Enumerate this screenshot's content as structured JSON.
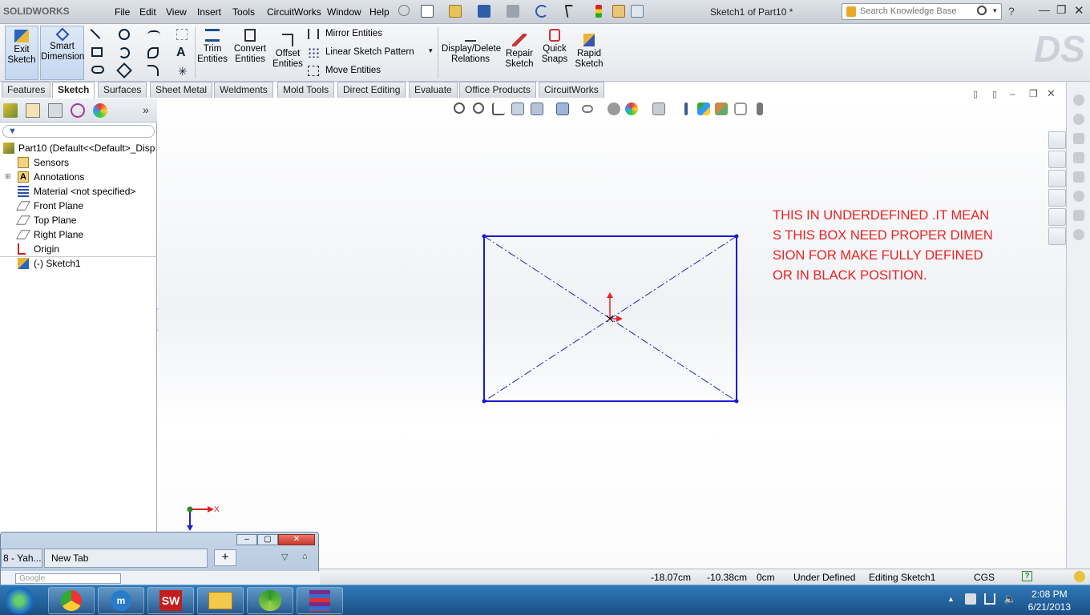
{
  "app": {
    "logo": "SOLIDWORKS",
    "doc_title": "Sketch1 of Part10 *"
  },
  "menu": [
    "File",
    "Edit",
    "View",
    "Insert",
    "Tools",
    "CircuitWorks",
    "Window",
    "Help"
  ],
  "search": {
    "placeholder": "Search Knowledge Base"
  },
  "ribbon": {
    "exit_sketch": "Exit Sketch",
    "smart_dimension": "Smart Dimension",
    "trim": "Trim Entities",
    "convert": "Convert Entities",
    "offset": "Offset Entities",
    "mirror": "Mirror Entities",
    "linear_pattern": "Linear Sketch Pattern",
    "move": "Move Entities",
    "display_delete": "Display/Delete Relations",
    "repair": "Repair Sketch",
    "quick_snaps": "Quick Snaps",
    "rapid": "Rapid Sketch"
  },
  "tabs": [
    "Features",
    "Sketch",
    "Surfaces",
    "Sheet Metal",
    "Weldments",
    "Mold Tools",
    "Direct Editing",
    "Evaluate",
    "Office Products",
    "CircuitWorks"
  ],
  "active_tab": "Sketch",
  "tree": [
    {
      "label": "Part10  (Default<<Default>_Disp",
      "icon": "part-icon"
    },
    {
      "label": "Sensors",
      "icon": "sensor-icon"
    },
    {
      "label": "Annotations",
      "icon": "annotation-icon"
    },
    {
      "label": "Material <not specified>",
      "icon": "material-icon"
    },
    {
      "label": "Front Plane",
      "icon": "plane-icon"
    },
    {
      "label": "Top Plane",
      "icon": "plane-icon"
    },
    {
      "label": "Right Plane",
      "icon": "plane-icon"
    },
    {
      "label": "Origin",
      "icon": "origin-icon"
    },
    {
      "label": "(-) Sketch1",
      "icon": "sketch-icon"
    }
  ],
  "annotation_text": "THIS IN UNDERDEFINED .IT MEAN\nS THIS BOX NEED PROPER DIMEN\nSION  FOR MAKE FULLY DEFINED\nOR IN BLACK POSITION.",
  "triad": {
    "x_label": "X"
  },
  "browser": {
    "tab1": "8 - Yah...",
    "tab2": "New Tab",
    "search_placeholder": "Google"
  },
  "status": {
    "x": "-18.07cm",
    "y": "-10.38cm",
    "z": "0cm",
    "state": "Under Defined",
    "mode": "Editing Sketch1",
    "units": "CGS"
  },
  "clock": {
    "time": "2:08 PM",
    "date": "6/21/2013"
  },
  "colors": {
    "sketch_line": "#1a1ad0",
    "annotation": "#e22222",
    "accent": "#c21e1e"
  }
}
